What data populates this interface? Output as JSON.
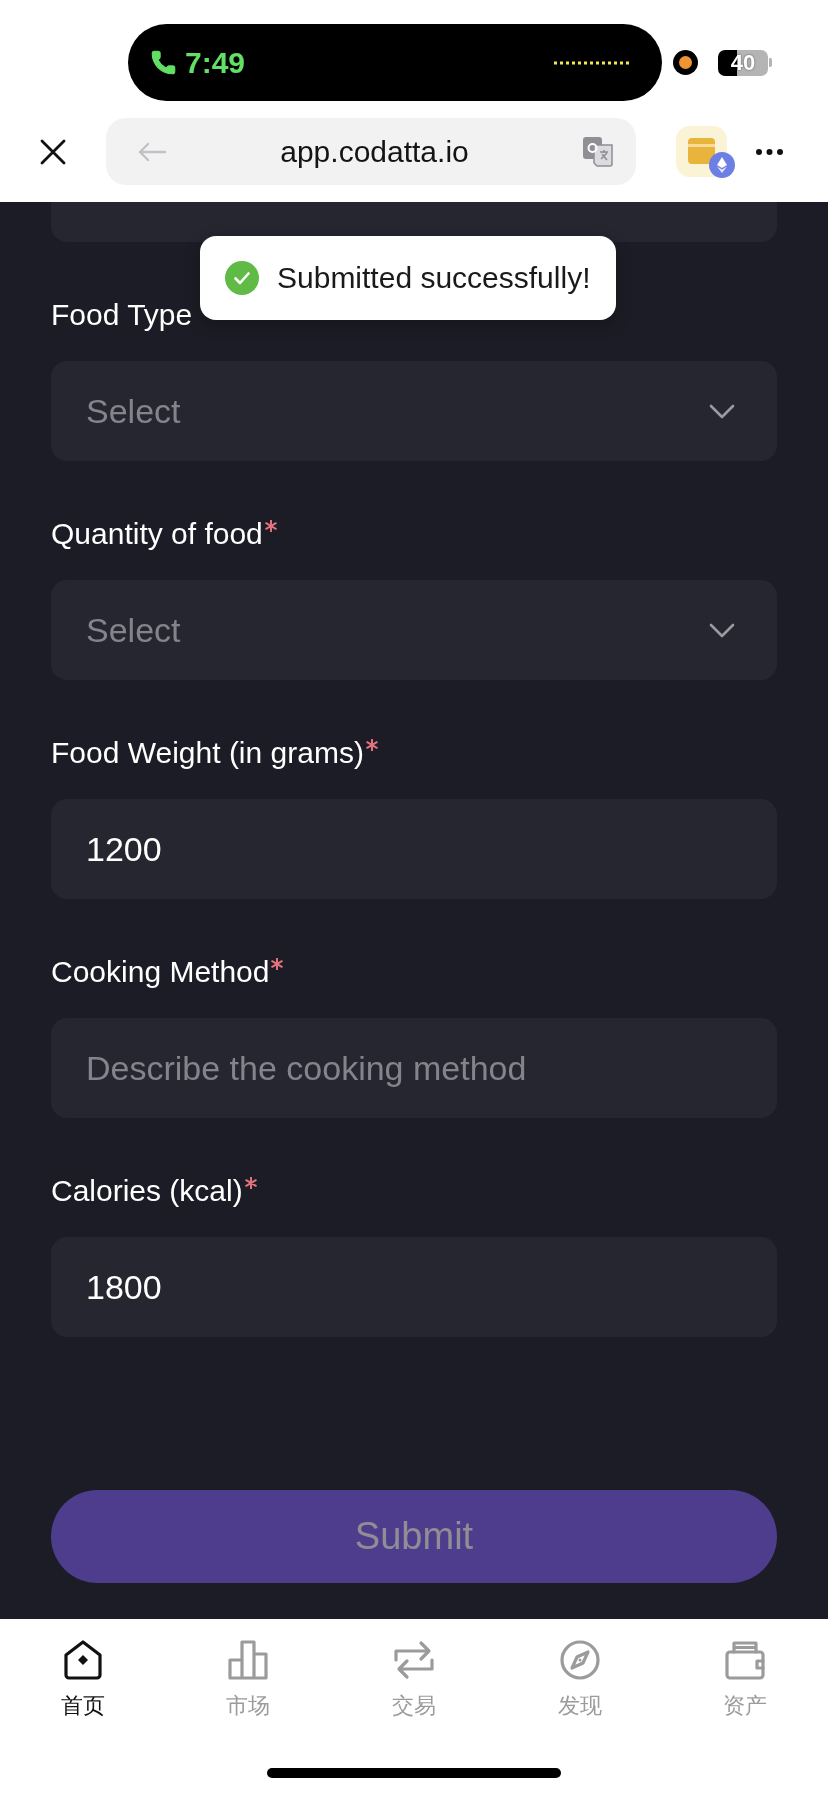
{
  "status_bar": {
    "time": "7:49",
    "battery": "40"
  },
  "browser": {
    "url": "app.codatta.io"
  },
  "toast": {
    "message": "Submitted successfully!"
  },
  "form": {
    "fields": [
      {
        "kind": "select",
        "label": "Food Type",
        "required": false,
        "placeholder": "Select"
      },
      {
        "kind": "select",
        "label": "Quantity of food",
        "required": true,
        "placeholder": "Select"
      },
      {
        "kind": "input",
        "label": "Food Weight (in grams)",
        "required": true,
        "value": "1200"
      },
      {
        "kind": "input",
        "label": "Cooking Method",
        "required": true,
        "placeholder": "Describe the cooking method"
      },
      {
        "kind": "input",
        "label": "Calories (kcal)",
        "required": true,
        "value": "1800"
      }
    ],
    "submit": {
      "label": "Submit",
      "disabled": true
    }
  },
  "nav": {
    "items": [
      {
        "label": "首页",
        "selected": true
      },
      {
        "label": "市场",
        "selected": false
      },
      {
        "label": "交易",
        "selected": false
      },
      {
        "label": "发现",
        "selected": false
      },
      {
        "label": "资产",
        "selected": false
      }
    ]
  }
}
